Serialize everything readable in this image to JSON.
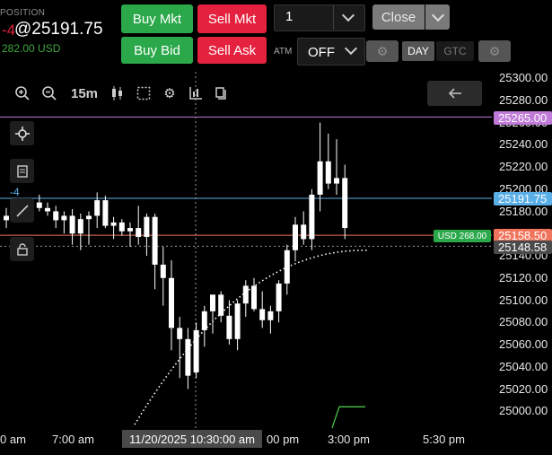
{
  "position": {
    "label": "POSITION",
    "qty": "-4",
    "price": "@25191.75",
    "pnl": "282.00 USD"
  },
  "orders": {
    "buy_mkt": "Buy Mkt",
    "sell_mkt": "Sell Mkt",
    "buy_bid": "Buy Bid",
    "sell_ask": "Sell Ask",
    "quantity": "1",
    "close": "Close",
    "atm_label": "ATM",
    "atm_value": "OFF",
    "day": "DAY",
    "gtc": "GTC"
  },
  "chart": {
    "timeframe": "15m",
    "position_marker": "-4",
    "crosshair_time": "11/20/2025 10:30:00 am",
    "pnl_tag": "USD 268.00",
    "price_tags": {
      "alert": "25265.00",
      "entry": "25191.75",
      "last": "25158.50",
      "avg": "25148.58"
    },
    "colors": {
      "alert": "#c07ad8",
      "entry": "#5aaee6",
      "last": "#f0745c",
      "avg": "#4a4a4a",
      "pnl": "#2aa84a"
    }
  },
  "chart_data": {
    "type": "candlestick",
    "y_ticks": [
      "25300.00",
      "25280.00",
      "25260.00",
      "25240.00",
      "25220.00",
      "25200.00",
      "25180.00",
      "25160.00",
      "25140.00",
      "25120.00",
      "25100.00",
      "25080.00",
      "25060.00",
      "25040.00",
      "25020.00",
      "25000.00"
    ],
    "x_ticks": [
      "0 am",
      "7:00 am",
      "00 pm",
      "3:00 pm",
      "5:30 pm"
    ],
    "candles": [
      [
        25172,
        25183,
        25165,
        25176
      ],
      [
        25176,
        25192,
        25170,
        25185
      ],
      [
        25185,
        25188,
        25170,
        25175
      ],
      [
        25175,
        25190,
        25172,
        25188
      ],
      [
        25188,
        25195,
        25180,
        25183
      ],
      [
        25183,
        25188,
        25176,
        25180
      ],
      [
        25180,
        25185,
        25165,
        25172
      ],
      [
        25172,
        25180,
        25160,
        25176
      ],
      [
        25176,
        25182,
        25150,
        25160
      ],
      [
        25160,
        25178,
        25145,
        25173
      ],
      [
        25173,
        25180,
        25150,
        25176
      ],
      [
        25176,
        25197,
        25165,
        25190
      ],
      [
        25190,
        25194,
        25165,
        25167
      ],
      [
        25167,
        25175,
        25155,
        25170
      ],
      [
        25170,
        25173,
        25158,
        25162
      ],
      [
        25162,
        25170,
        25148,
        25165
      ],
      [
        25165,
        25185,
        25150,
        25157
      ],
      [
        25157,
        25178,
        25140,
        25175
      ],
      [
        25175,
        25178,
        25110,
        25132
      ],
      [
        25132,
        25148,
        25095,
        25120
      ],
      [
        25120,
        25136,
        25055,
        25075
      ],
      [
        25075,
        25085,
        25030,
        25065
      ],
      [
        25065,
        25075,
        25020,
        25032
      ],
      [
        25035,
        25080,
        25030,
        25073
      ],
      [
        25073,
        25095,
        25058,
        25090
      ],
      [
        25090,
        25105,
        25070,
        25105
      ],
      [
        25105,
        25108,
        25080,
        25086
      ],
      [
        25086,
        25100,
        25060,
        25065
      ],
      [
        25065,
        25100,
        25055,
        25097
      ],
      [
        25097,
        25118,
        25085,
        25113
      ],
      [
        25113,
        25120,
        25090,
        25092
      ],
      [
        25092,
        25108,
        25075,
        25082
      ],
      [
        25082,
        25095,
        25070,
        25090
      ],
      [
        25090,
        25118,
        25080,
        25115
      ],
      [
        25115,
        25150,
        25105,
        25145
      ],
      [
        25145,
        25175,
        25135,
        25168
      ],
      [
        25168,
        25180,
        25150,
        25155
      ],
      [
        25155,
        25200,
        25145,
        25195
      ],
      [
        25195,
        25260,
        25180,
        25225
      ],
      [
        25225,
        25250,
        25200,
        25205
      ],
      [
        25205,
        25245,
        25195,
        25210
      ],
      [
        25210,
        25222,
        25155,
        25165
      ]
    ],
    "series": [
      {
        "name": "",
        "type": "dotted-line"
      }
    ]
  }
}
